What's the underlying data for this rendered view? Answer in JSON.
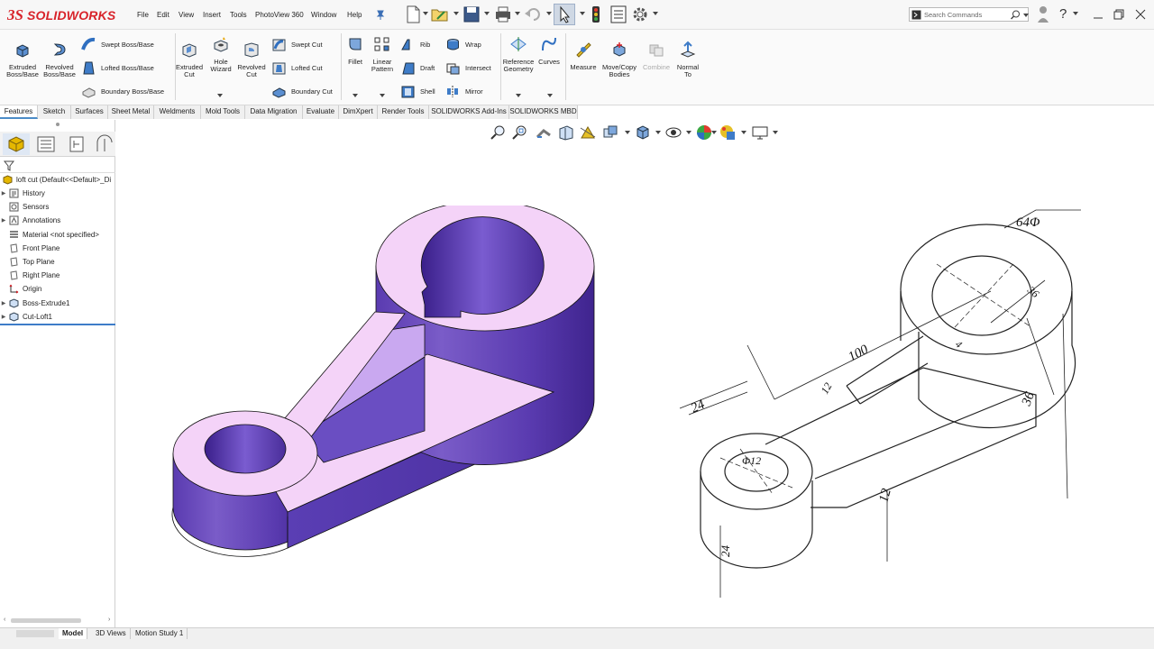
{
  "app": {
    "brand": "SOLIDWORKS",
    "brand_prefix": "3S"
  },
  "menu": [
    "File",
    "Edit",
    "View",
    "Insert",
    "Tools",
    "PhotoView 360",
    "Window",
    "Help"
  ],
  "search": {
    "placeholder": "Search Commands"
  },
  "ribbon": {
    "extruded_boss": "Extruded Boss/Base",
    "revolved_boss": "Revolved Boss/Base",
    "swept_boss": "Swept Boss/Base",
    "lofted_boss": "Lofted Boss/Base",
    "boundary_boss": "Boundary Boss/Base",
    "extruded_cut": "Extruded Cut",
    "hole_wizard": "Hole Wizard",
    "revolved_cut": "Revolved Cut",
    "swept_cut": "Swept Cut",
    "lofted_cut": "Lofted Cut",
    "boundary_cut": "Boundary Cut",
    "fillet": "Fillet",
    "linear_pattern": "Linear Pattern",
    "rib": "Rib",
    "draft": "Draft",
    "shell": "Shell",
    "wrap": "Wrap",
    "intersect": "Intersect",
    "mirror": "Mirror",
    "reference_geometry": "Reference Geometry",
    "curves": "Curves",
    "measure": "Measure",
    "move_copy": "Move/Copy Bodies",
    "combine": "Combine",
    "normal_to": "Normal To"
  },
  "tabs": [
    "Features",
    "Sketch",
    "Surfaces",
    "Sheet Metal",
    "Weldments",
    "Mold Tools",
    "Data Migration",
    "Evaluate",
    "DimXpert",
    "Render Tools",
    "SOLIDWORKS Add-Ins",
    "SOLIDWORKS MBD"
  ],
  "tree": {
    "root": "loft cut  (Default<<Default>_Di",
    "items": [
      {
        "label": "History",
        "expandable": true,
        "icon": "history-icon"
      },
      {
        "label": "Sensors",
        "expandable": false,
        "icon": "sensors-icon"
      },
      {
        "label": "Annotations",
        "expandable": true,
        "icon": "annotations-icon"
      },
      {
        "label": "Material <not specified>",
        "expandable": false,
        "icon": "material-icon"
      },
      {
        "label": "Front Plane",
        "expandable": false,
        "icon": "plane-icon"
      },
      {
        "label": "Top Plane",
        "expandable": false,
        "icon": "plane-icon"
      },
      {
        "label": "Right Plane",
        "expandable": false,
        "icon": "plane-icon"
      },
      {
        "label": "Origin",
        "expandable": false,
        "icon": "origin-icon"
      },
      {
        "label": "Boss-Extrude1",
        "expandable": true,
        "icon": "feature-icon"
      },
      {
        "label": "Cut-Loft1",
        "expandable": true,
        "icon": "feature-icon"
      }
    ]
  },
  "bottom_tabs": [
    "Model",
    "3D Views",
    "Motion Study 1"
  ],
  "sketch_dims": [
    "64Φ",
    "100",
    "36",
    "12",
    "24",
    "Φ12",
    "12",
    "24",
    "36",
    "4"
  ],
  "colors": {
    "part_top": "#f2cef7",
    "part_side": "#6f4dbd",
    "part_dark": "#4d2f9a",
    "brand": "#d8232a"
  }
}
